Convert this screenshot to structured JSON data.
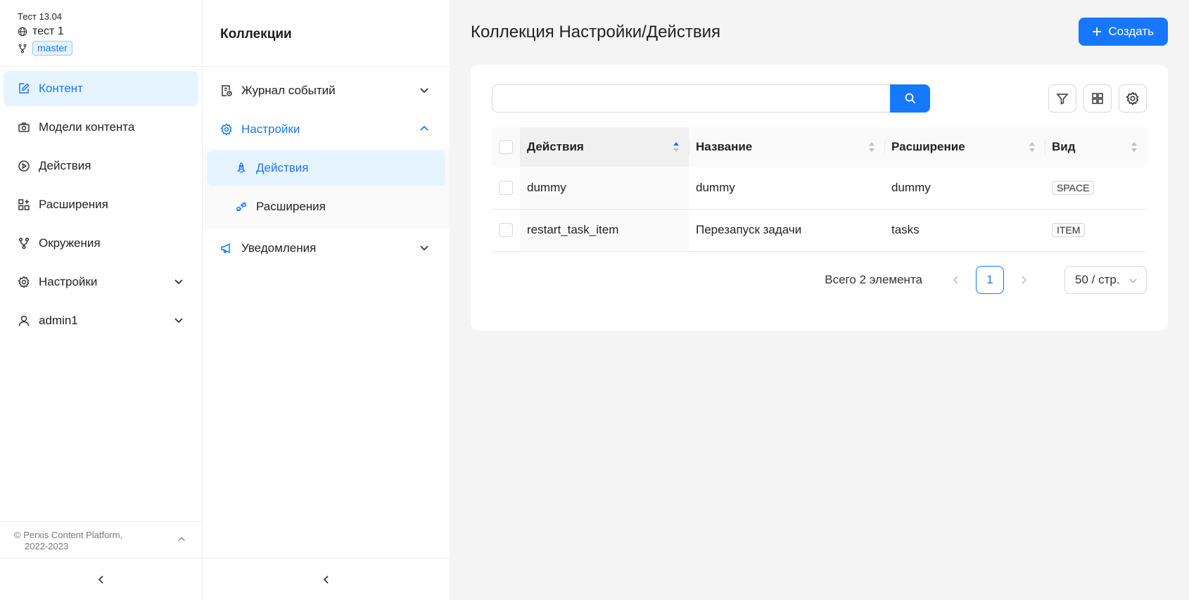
{
  "space": {
    "org": "Тест 13.04",
    "name": "тест 1",
    "branch": "master"
  },
  "nav": {
    "items": [
      {
        "label": "Контент",
        "icon": "edit-icon"
      },
      {
        "label": "Модели контента",
        "icon": "camera-icon"
      },
      {
        "label": "Действия",
        "icon": "play-circle-icon"
      },
      {
        "label": "Расширения",
        "icon": "apps-icon"
      },
      {
        "label": "Окружения",
        "icon": "branch-icon"
      },
      {
        "label": "Настройки",
        "icon": "gear-icon"
      },
      {
        "label": "admin1",
        "icon": "user-icon"
      }
    ]
  },
  "footer": {
    "copyright": "© Perxis Content Platform,",
    "years": "2022-2023"
  },
  "collections": {
    "title": "Коллекции",
    "items": [
      {
        "label": "Журнал событий",
        "icon": "log-icon"
      },
      {
        "label": "Настройки",
        "icon": "gear-icon"
      },
      {
        "label": "Уведомления",
        "icon": "megaphone-icon"
      }
    ],
    "sub_items": [
      {
        "label": "Действия",
        "icon": "rocket-icon"
      },
      {
        "label": "Расширения",
        "icon": "plug-icon"
      }
    ]
  },
  "main": {
    "title": "Коллекция Настройки/Действия",
    "create_label": "Создать",
    "search_placeholder": ""
  },
  "table": {
    "columns": [
      "Действия",
      "Название",
      "Расширение",
      "Вид"
    ],
    "rows": [
      {
        "action": "dummy",
        "name": "dummy",
        "extension": "dummy",
        "kind": "SPACE"
      },
      {
        "action": "restart_task_item",
        "name": "Перезапуск задачи",
        "extension": "tasks",
        "kind": "ITEM"
      }
    ]
  },
  "pagination": {
    "total": "Всего 2 элемента",
    "current": "1",
    "page_size": "50 / стр."
  },
  "colors": {
    "accent": "#1677ff",
    "active_bg": "#e6f4ff"
  }
}
